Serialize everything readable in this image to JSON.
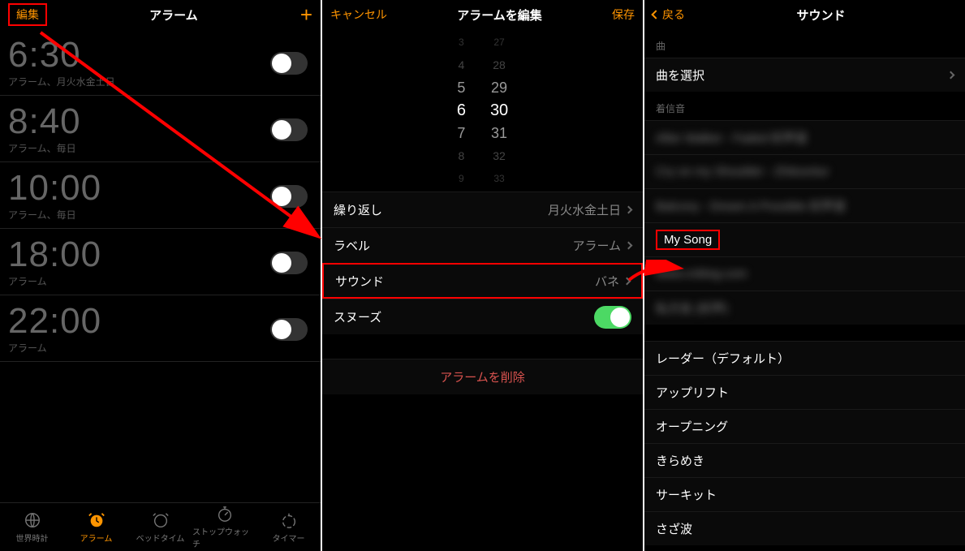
{
  "pane1": {
    "nav": {
      "left": "編集",
      "title": "アラーム",
      "right": "+"
    },
    "alarms": [
      {
        "time": "6:30",
        "sub": "アラーム、月火水金土日",
        "on": false
      },
      {
        "time": "8:40",
        "sub": "アラーム、毎日",
        "on": false
      },
      {
        "time": "10:00",
        "sub": "アラーム、毎日",
        "on": false
      },
      {
        "time": "18:00",
        "sub": "アラーム",
        "on": false
      },
      {
        "time": "22:00",
        "sub": "アラーム",
        "on": false
      }
    ],
    "tabs": [
      {
        "label": "世界時計"
      },
      {
        "label": "アラーム"
      },
      {
        "label": "ベッドタイム"
      },
      {
        "label": "ストップウォッチ"
      },
      {
        "label": "タイマー"
      }
    ]
  },
  "pane2": {
    "nav": {
      "left": "キャンセル",
      "title": "アラームを編集",
      "right": "保存"
    },
    "picker": {
      "hour": "6",
      "minute": "30",
      "hm2": "27",
      "hm1": "28",
      "hn": "29",
      "hp": "31",
      "hp2": "32",
      "hp3": "33",
      "hm3": "3",
      "hh2": "4",
      "hh1": "5",
      "hhp": "7",
      "hhp2": "8",
      "hhp3": "9"
    },
    "rows": {
      "repeat_label": "繰り返し",
      "repeat_val": "月火水金土日",
      "label_label": "ラベル",
      "label_val": "アラーム",
      "sound_label": "サウンド",
      "sound_val": "バネ",
      "snooze_label": "スヌーズ"
    },
    "delete": "アラームを削除"
  },
  "pane3": {
    "nav": {
      "left": "戻る",
      "title": "サウンド"
    },
    "song_section": "曲",
    "choose_song": "曲を選択",
    "ring_section": "着信音",
    "blurred": [
      "After Walker - Faded  好声音",
      "Cry on my Shoulder - Zhitoontur",
      "Balcony - Dream A Possible  好声音",
      "My Song",
      "www.cnblog.com",
      "私方友 (好声)"
    ],
    "mysong": "My Song",
    "tones": [
      "レーダー（デフォルト）",
      "アップリフト",
      "オープニング",
      "きらめき",
      "サーキット",
      "さざ波"
    ]
  }
}
